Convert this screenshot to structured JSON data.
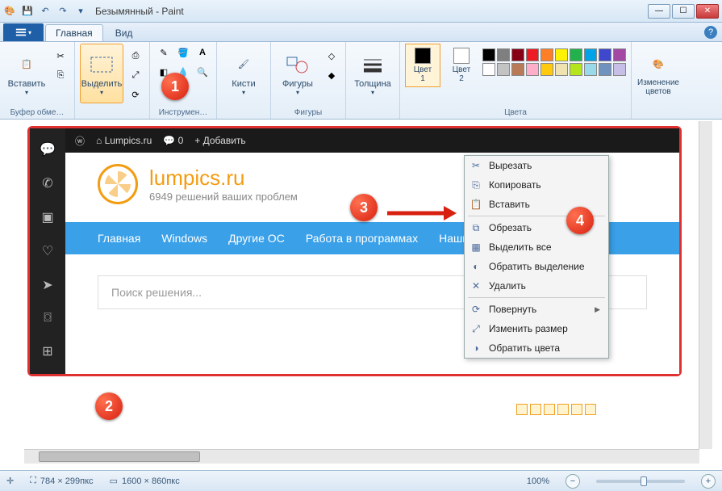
{
  "window": {
    "title": "Безымянный - Paint"
  },
  "tabs": {
    "home": "Главная",
    "view": "Вид"
  },
  "ribbon": {
    "paste": "Вставить",
    "select": "Выделить",
    "clipboard_label": "Буфер обме…",
    "tools_label": "Инструмен…",
    "brushes": "Кисти",
    "shapes": "Фигуры",
    "shapes_label": "Фигуры",
    "size": "Толщина",
    "color1": "Цвет\n1",
    "color2": "Цвет\n2",
    "colors_label": "Цвета",
    "editcolors": "Изменение\nцветов"
  },
  "admin": {
    "site": "Lumpics.ru",
    "comments": "0",
    "add": "Добавить"
  },
  "site": {
    "brand": "lumpics.ru",
    "tagline": "6949 решений ваших проблем",
    "nav": [
      "Главная",
      "Windows",
      "Другие ОС",
      "Работа в программах",
      "Наши сервисы"
    ],
    "search_placeholder": "Поиск решения..."
  },
  "ctx": {
    "cut": "Вырезать",
    "copy": "Копировать",
    "paste": "Вставить",
    "crop": "Обрезать",
    "selectall": "Выделить все",
    "invert": "Обратить выделение",
    "delete": "Удалить",
    "rotate": "Повернуть",
    "resize": "Изменить размер",
    "invertcolors": "Обратить цвета"
  },
  "status": {
    "sel_size": "784 × 299пкс",
    "canvas_size": "1600 × 860пкс",
    "zoom": "100%"
  },
  "badges": {
    "b1": "1",
    "b2": "2",
    "b3": "3",
    "b4": "4"
  },
  "palette_colors": [
    "#000",
    "#7f7f7f",
    "#880015",
    "#ed1c24",
    "#ff7f27",
    "#fff200",
    "#22b14c",
    "#00a2e8",
    "#3f48cc",
    "#a349a4",
    "#fff",
    "#c3c3c3",
    "#b97a57",
    "#ffaec9",
    "#ffc90e",
    "#efe4b0",
    "#b5e61d",
    "#99d9ea",
    "#7092be",
    "#c8bfe7"
  ]
}
